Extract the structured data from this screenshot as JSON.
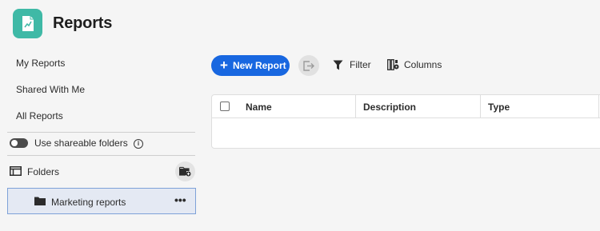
{
  "header": {
    "title": "Reports",
    "app_icon": "reports-chart-icon",
    "accent": "#3fb9a6"
  },
  "sidebar": {
    "nav": [
      {
        "label": "My Reports"
      },
      {
        "label": "Shared With Me"
      },
      {
        "label": "All Reports"
      }
    ],
    "toggle": {
      "label": "Use shareable folders",
      "on": true
    },
    "folders": {
      "label": "Folders"
    },
    "folder_items": [
      {
        "label": "Marketing reports",
        "selected": true
      }
    ]
  },
  "toolbar": {
    "new_report_label": "New Report",
    "filter_label": "Filter",
    "columns_label": "Columns",
    "primary_color": "#1867e0"
  },
  "table": {
    "columns": [
      "Name",
      "Description",
      "Type"
    ],
    "rows": []
  }
}
